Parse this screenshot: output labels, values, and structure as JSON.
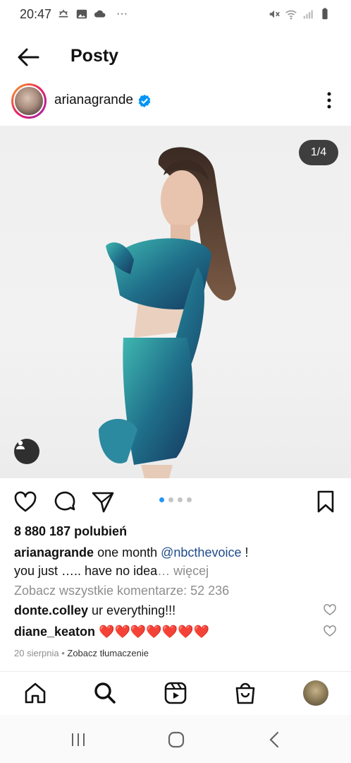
{
  "status_bar": {
    "time": "20:47",
    "more": "···",
    "left_icons": [
      "weather-icon",
      "gallery-icon",
      "cloud-icon"
    ],
    "right_icons": [
      "mute-icon",
      "wifi-icon",
      "signal-icon",
      "battery-icon"
    ]
  },
  "header": {
    "title": "Posty",
    "back_icon": "arrow-left-icon"
  },
  "post": {
    "username": "arianagrande",
    "verified": true,
    "image_counter": "1/4",
    "carousel_count": 4,
    "carousel_active": 1,
    "likes": "8 880 187 polubień",
    "caption": {
      "user": "arianagrande",
      "text_before": "one month",
      "mention": "@nbcthevoice",
      "text_after": "!",
      "line2": "you just ….. have no idea",
      "more": "… więcej"
    },
    "view_comments": "Zobacz wszystkie komentarze: 52 236",
    "comments": [
      {
        "user": "donte.colley",
        "text": "ur everything!!!"
      },
      {
        "user": "diane_keaton",
        "text": "❤️❤️❤️❤️❤️❤️❤️"
      }
    ],
    "date": "20 sierpnia",
    "separator": " • ",
    "translate": "Zobacz tłumaczenie"
  },
  "bottom_nav": [
    "home-icon",
    "search-icon",
    "reels-icon",
    "shop-icon",
    "profile-avatar"
  ],
  "colors": {
    "accent_blue": "#2196f3",
    "verified_blue": "#0095f6",
    "mention_blue": "#1e4b8a",
    "heart_red": "#e0245e",
    "muted": "#8e8e8e"
  }
}
